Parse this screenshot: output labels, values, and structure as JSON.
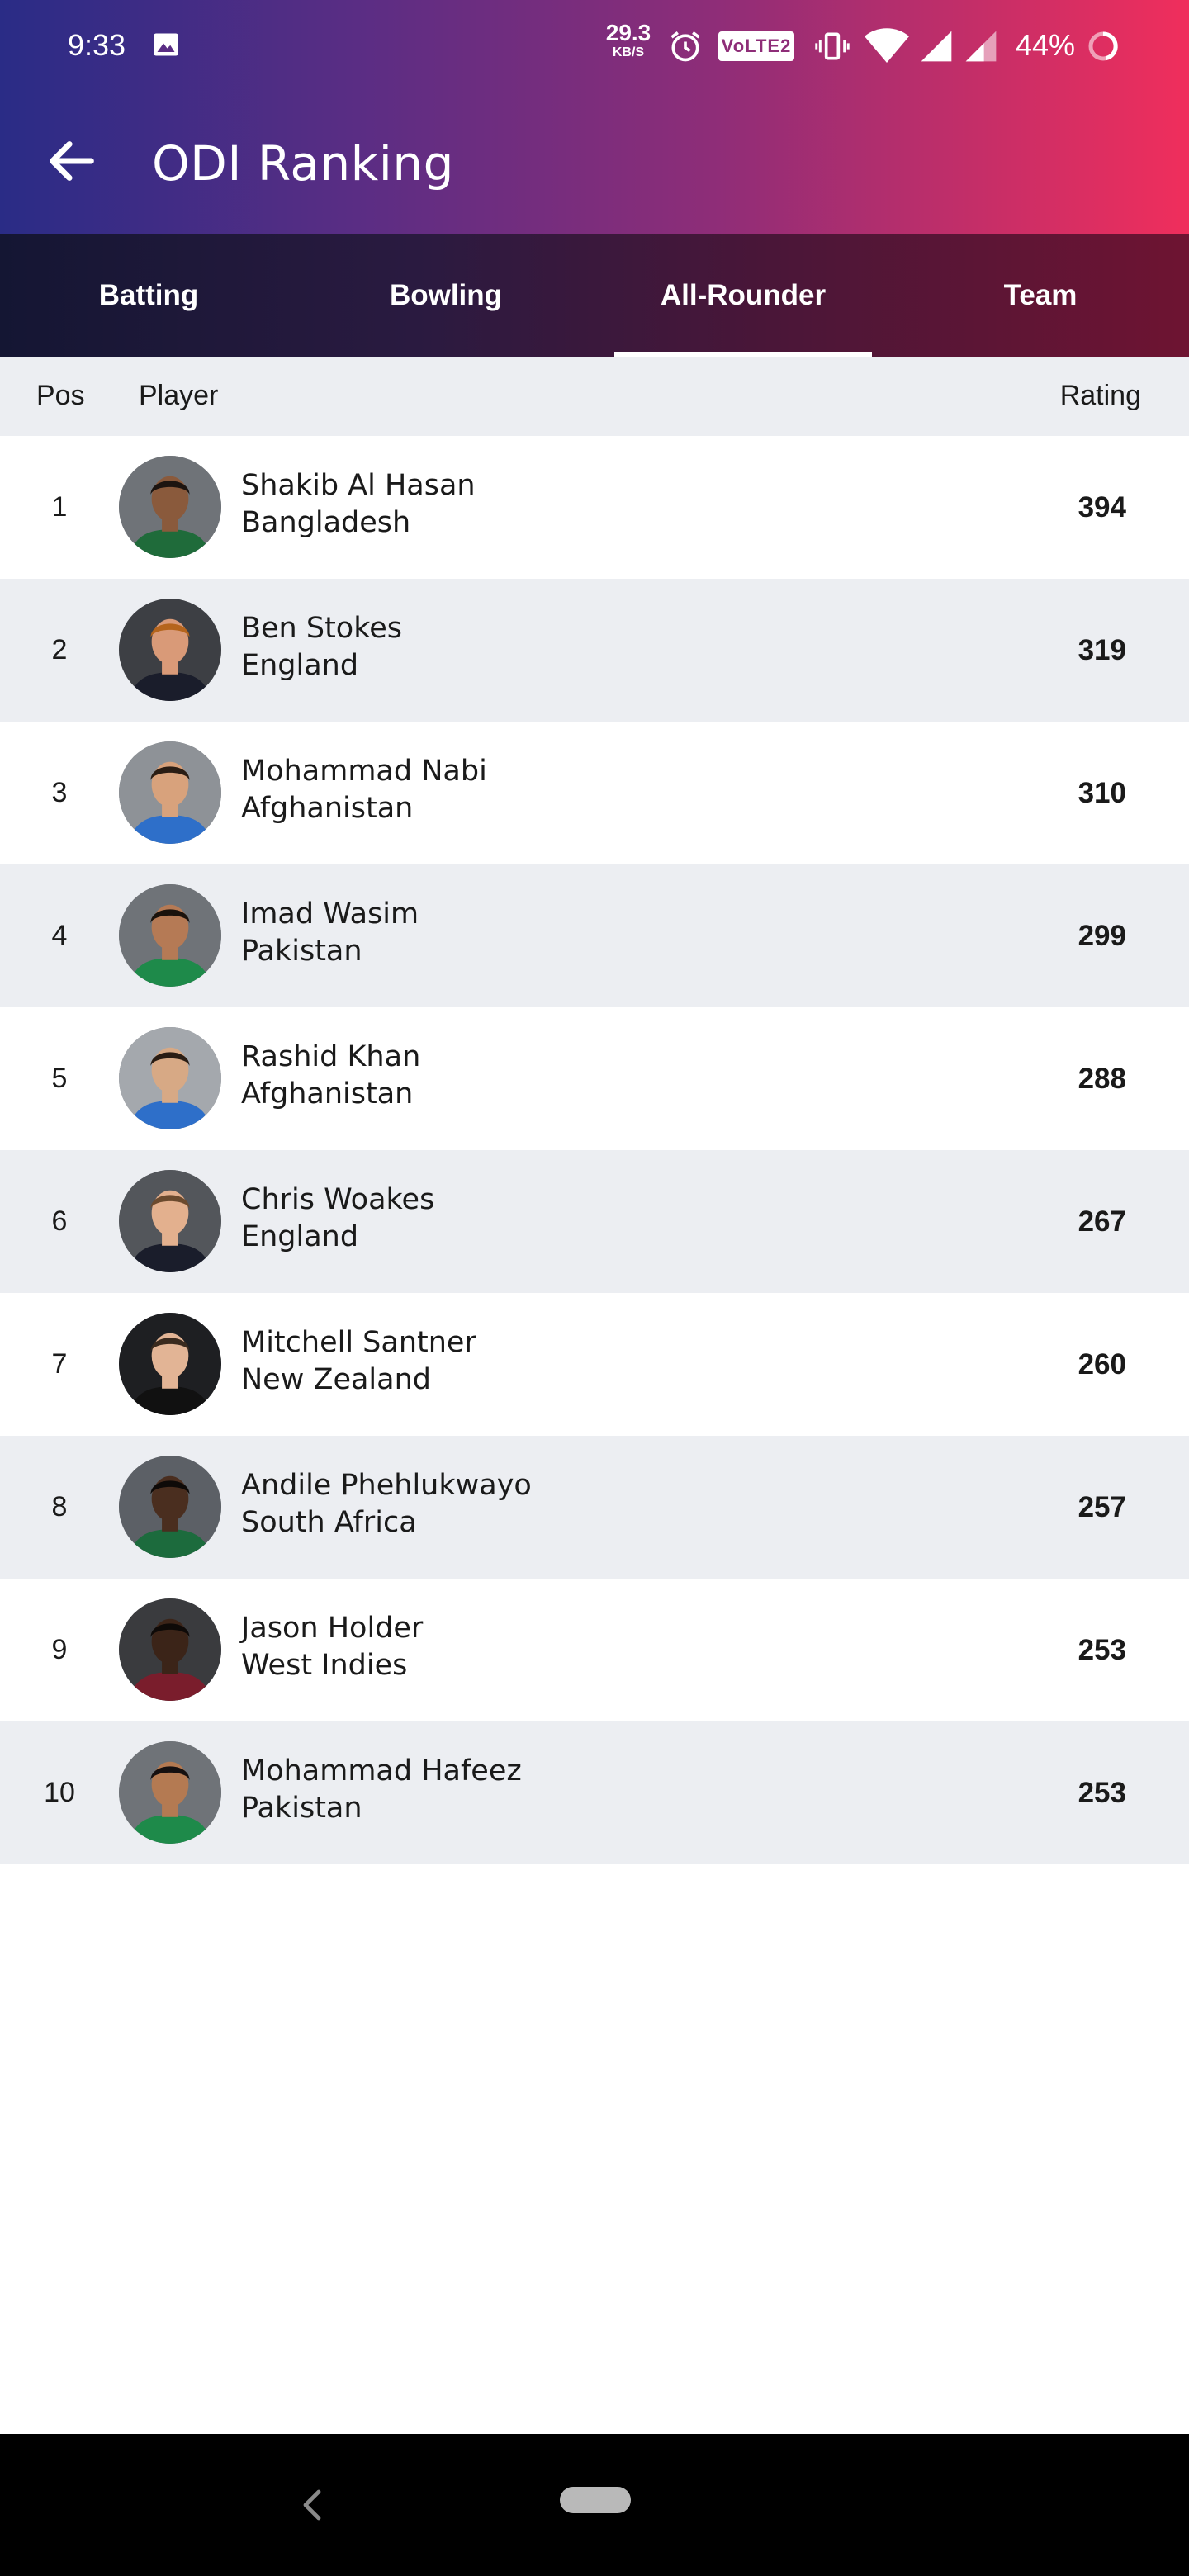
{
  "status_bar": {
    "time": "9:33",
    "net_speed_value": "29.3",
    "net_speed_unit": "KB/S",
    "volte_label": "VoLTE2",
    "battery": "44%"
  },
  "header": {
    "title": "ODI Ranking",
    "gradient_colors": [
      "#2a2c86",
      "#8e2d78",
      "#f02e5c"
    ]
  },
  "tabs": [
    {
      "label": "Batting",
      "active": false
    },
    {
      "label": "Bowling",
      "active": false
    },
    {
      "label": "All-Rounder",
      "active": true
    },
    {
      "label": "Team",
      "active": false
    }
  ],
  "columns": {
    "pos": "Pos",
    "player": "Player",
    "rating": "Rating"
  },
  "rankings": [
    {
      "pos": "1",
      "name": "Shakib Al Hasan",
      "country": "Bangladesh",
      "rating": "394"
    },
    {
      "pos": "2",
      "name": "Ben Stokes",
      "country": "England",
      "rating": "319"
    },
    {
      "pos": "3",
      "name": "Mohammad Nabi",
      "country": "Afghanistan",
      "rating": "310"
    },
    {
      "pos": "4",
      "name": "Imad Wasim",
      "country": "Pakistan",
      "rating": "299"
    },
    {
      "pos": "5",
      "name": "Rashid Khan",
      "country": "Afghanistan",
      "rating": "288"
    },
    {
      "pos": "6",
      "name": "Chris Woakes",
      "country": "England",
      "rating": "267"
    },
    {
      "pos": "7",
      "name": "Mitchell Santner",
      "country": "New Zealand",
      "rating": "260"
    },
    {
      "pos": "8",
      "name": "Andile Phehlukwayo",
      "country": "South Africa",
      "rating": "257"
    },
    {
      "pos": "9",
      "name": "Jason Holder",
      "country": "West Indies",
      "rating": "253"
    },
    {
      "pos": "10",
      "name": "Mohammad Hafeez",
      "country": "Pakistan",
      "rating": "253"
    }
  ],
  "avatars": [
    {
      "bg": "#6f7378",
      "skin": "#8a5a3c",
      "hair": "#1c1410",
      "shirt": "#1f6b3a"
    },
    {
      "bg": "#3d3f44",
      "skin": "#d99a78",
      "hair": "#b5651d",
      "shirt": "#1a1d2b"
    },
    {
      "bg": "#8e9297",
      "skin": "#d8a27c",
      "hair": "#2a1d14",
      "shirt": "#2e6fc9"
    },
    {
      "bg": "#6f7378",
      "skin": "#b57a55",
      "hair": "#1a120c",
      "shirt": "#1e8a4a"
    },
    {
      "bg": "#a4a8ad",
      "skin": "#d7a985",
      "hair": "#2a1d14",
      "shirt": "#2e6fc9"
    },
    {
      "bg": "#53565b",
      "skin": "#e3b08e",
      "hair": "#6b4a2e",
      "shirt": "#1a1d2b"
    },
    {
      "bg": "#1e1f22",
      "skin": "#e2b495",
      "hair": "#3a2a1e",
      "shirt": "#111111"
    },
    {
      "bg": "#5c6066",
      "skin": "#4a2e1f",
      "hair": "#0e0a08",
      "shirt": "#1c6b3d"
    },
    {
      "bg": "#3a3b3e",
      "skin": "#3b2418",
      "hair": "#0e0a08",
      "shirt": "#7a1d2c"
    },
    {
      "bg": "#6f7378",
      "skin": "#b47a52",
      "hair": "#151010",
      "shirt": "#1e8a4a"
    }
  ]
}
